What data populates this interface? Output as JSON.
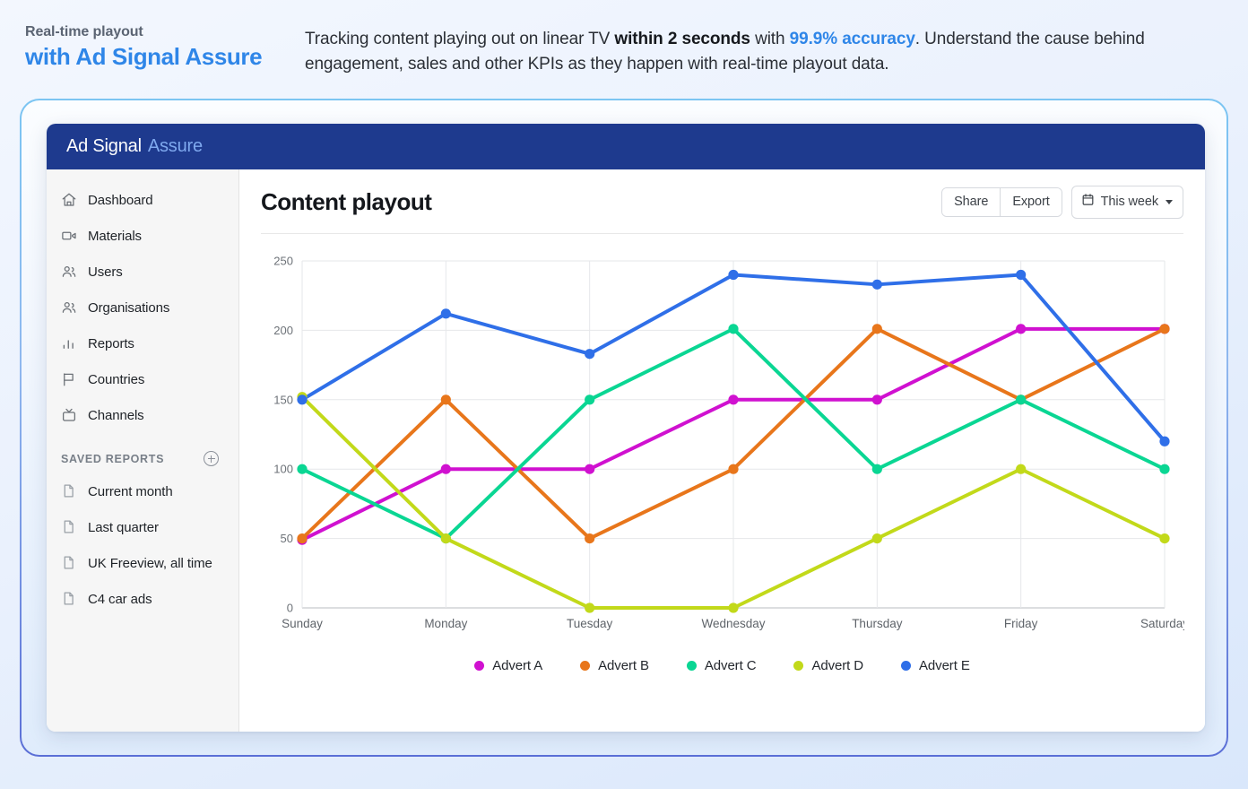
{
  "headline": {
    "kicker": "Real-time playout",
    "main": "with Ad Signal Assure",
    "desc_part1": "Tracking content playing out on linear TV ",
    "desc_bold": "within 2 seconds",
    "desc_part2": " with ",
    "desc_accent": "99.9% accuracy",
    "desc_part3": ". Understand the cause behind engagement, sales and other KPIs as they happen with real-time playout data.",
    "accent_color": "#2f86e8"
  },
  "app": {
    "brand": "Ad Signal",
    "brand_accent": "Assure",
    "header_color": "#1e3a8e"
  },
  "sidebar": {
    "items": [
      {
        "label": "Dashboard",
        "icon": "home-icon"
      },
      {
        "label": "Materials",
        "icon": "video-icon"
      },
      {
        "label": "Users",
        "icon": "users-icon"
      },
      {
        "label": "Organisations",
        "icon": "users-icon"
      },
      {
        "label": "Reports",
        "icon": "bar-chart-icon"
      },
      {
        "label": "Countries",
        "icon": "flag-icon"
      },
      {
        "label": "Channels",
        "icon": "tv-icon"
      }
    ],
    "saved_reports_title": "SAVED REPORTS",
    "add_report_icon": "plus-circle-icon",
    "saved_reports": [
      {
        "label": "Current month"
      },
      {
        "label": "Last quarter"
      },
      {
        "label": "UK Freeview, all time"
      },
      {
        "label": "C4 car ads"
      }
    ]
  },
  "main": {
    "title": "Content playout",
    "toolbar": {
      "share_label": "Share",
      "export_label": "Export",
      "date_label": "This week",
      "date_icon": "calendar-icon",
      "caret_icon": "chevron-down-icon"
    }
  },
  "chart_data": {
    "type": "line",
    "title": "Content playout",
    "xlabel": "",
    "ylabel": "",
    "categories": [
      "Sunday",
      "Monday",
      "Tuesday",
      "Wednesday",
      "Thursday",
      "Friday",
      "Saturday"
    ],
    "ylim": [
      0,
      250
    ],
    "yticks": [
      0,
      50,
      100,
      150,
      200,
      250
    ],
    "grid": true,
    "legend_position": "bottom",
    "series": [
      {
        "name": "Advert A",
        "color": "#d011d0",
        "values": [
          49,
          100,
          100,
          150,
          150,
          201,
          201
        ]
      },
      {
        "name": "Advert B",
        "color": "#e8761b",
        "values": [
          50,
          150,
          50,
          100,
          201,
          150,
          201
        ]
      },
      {
        "name": "Advert C",
        "color": "#0ad693",
        "values": [
          100,
          50,
          150,
          201,
          100,
          150,
          100
        ]
      },
      {
        "name": "Advert D",
        "color": "#c2d91a",
        "values": [
          152,
          50,
          0,
          0,
          50,
          100,
          50
        ]
      },
      {
        "name": "Advert E",
        "color": "#2f6fe8",
        "values": [
          150,
          212,
          183,
          240,
          233,
          240,
          120
        ]
      }
    ]
  }
}
